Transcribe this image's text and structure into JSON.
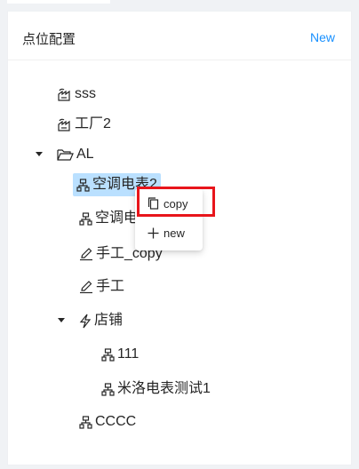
{
  "panel": {
    "title": "点位配置",
    "new_label": "New"
  },
  "tree": {
    "nodes": [
      {
        "label": "sss",
        "icon": "factory-icon",
        "expandable": false
      },
      {
        "label": "工厂2",
        "icon": "factory-icon",
        "expandable": false
      },
      {
        "label": "AL",
        "icon": "folder-open-icon",
        "expandable": true,
        "expanded": true
      },
      {
        "label": "空调电表2",
        "icon": "cluster-icon",
        "expandable": false,
        "selected": true
      },
      {
        "label": "空调电表",
        "icon": "cluster-icon",
        "expandable": false
      },
      {
        "label": "手工_copy",
        "icon": "edit-icon",
        "expandable": false
      },
      {
        "label": "手工",
        "icon": "edit-icon",
        "expandable": false
      },
      {
        "label": "店铺",
        "icon": "thunderbolt-icon",
        "expandable": true,
        "expanded": true
      },
      {
        "label": "111",
        "icon": "cluster-icon",
        "expandable": false
      },
      {
        "label": "米洛电表测试1",
        "icon": "cluster-icon",
        "expandable": false
      },
      {
        "label": "CCCC",
        "icon": "cluster-icon",
        "expandable": false
      }
    ]
  },
  "context_menu": {
    "items": [
      {
        "label": "copy",
        "icon": "copy-icon"
      },
      {
        "label": "new",
        "icon": "plus-icon"
      }
    ]
  },
  "colors": {
    "accent": "#1890ff",
    "selected_bg": "#bae0ff",
    "highlight": "#e8151b"
  }
}
